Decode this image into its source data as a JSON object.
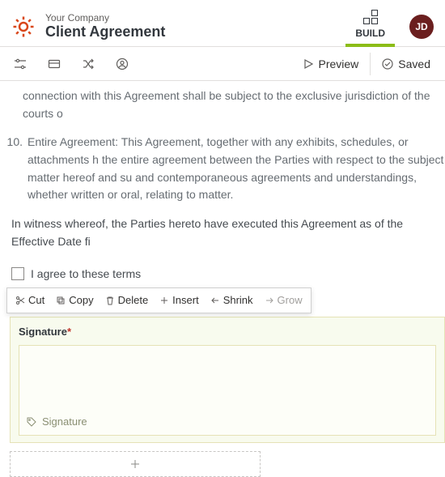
{
  "header": {
    "subtitle": "Your Company",
    "title": "Client Agreement",
    "mode_label": "BUILD",
    "avatar_initials": "JD"
  },
  "toolbar": {
    "preview_label": "Preview",
    "saved_label": "Saved"
  },
  "content": {
    "clause9_tail": "connection with this Agreement shall be subject to the exclusive jurisdiction of the courts o",
    "clause10_num": "10.",
    "clause10_text": "Entire Agreement: This Agreement, together with any exhibits, schedules, or attachments h the entire agreement between the Parties with respect to the subject matter hereof and su and contemporaneous agreements and understandings, whether written or oral, relating to matter.",
    "witness": "In witness whereof, the Parties hereto have executed this Agreement as of the Effective Date fi",
    "checkbox_label": "I agree to these terms"
  },
  "context_menu": {
    "cut": "Cut",
    "copy": "Copy",
    "delete": "Delete",
    "insert": "Insert",
    "shrink": "Shrink",
    "grow": "Grow"
  },
  "signature": {
    "label": "Signature",
    "required_marker": "*",
    "placeholder": "Signature"
  }
}
